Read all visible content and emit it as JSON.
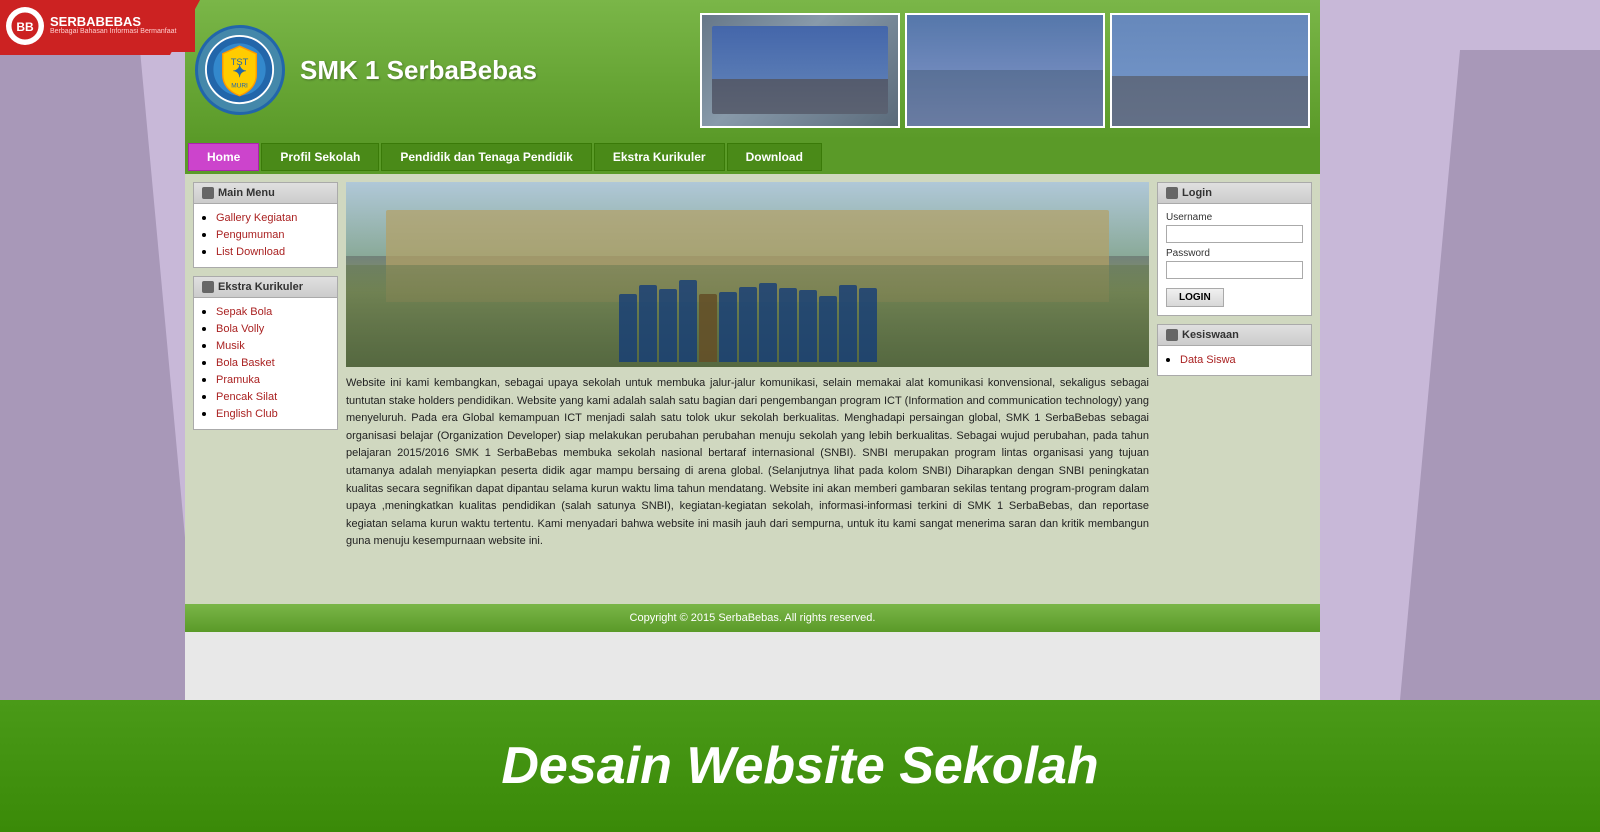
{
  "site": {
    "title": "SMK 1 SerbaBebas",
    "logo_text": "Berbagai Bahasan Informasi Bermanfaat",
    "copyright": "Copyright © 2015 SerbaBebas. All rights reserved."
  },
  "nav": {
    "items": [
      {
        "label": "Home",
        "active": true
      },
      {
        "label": "Profil Sekolah",
        "active": false
      },
      {
        "label": "Pendidik dan Tenaga Pendidik",
        "active": false
      },
      {
        "label": "Ekstra Kurikuler",
        "active": false
      },
      {
        "label": "Download",
        "active": false
      }
    ]
  },
  "sidebar": {
    "main_menu": {
      "title": "Main Menu",
      "items": [
        {
          "label": "Gallery Kegiatan",
          "href": "#"
        },
        {
          "label": "Pengumuman",
          "href": "#"
        },
        {
          "label": "List Download",
          "href": "#"
        }
      ]
    },
    "ekstra_kurikuler": {
      "title": "Ekstra Kurikuler",
      "items": [
        {
          "label": "Sepak Bola",
          "href": "#"
        },
        {
          "label": "Bola Volly",
          "href": "#"
        },
        {
          "label": "Musik",
          "href": "#"
        },
        {
          "label": "Bola Basket",
          "href": "#"
        },
        {
          "label": "Pramuka",
          "href": "#"
        },
        {
          "label": "Pencak Silat",
          "href": "#"
        },
        {
          "label": "English Club",
          "href": "#"
        }
      ]
    }
  },
  "login": {
    "title": "Login",
    "username_label": "Username",
    "password_label": "Password",
    "button_label": "LOGIN"
  },
  "kesiswaan": {
    "title": "Kesiswaan",
    "items": [
      {
        "label": "Data Siswa",
        "href": "#"
      }
    ]
  },
  "article": {
    "text": "Website ini kami kembangkan, sebagai upaya sekolah untuk membuka jalur-jalur komunikasi, selain memakai alat komunikasi konvensional, sekaligus sebagai tuntutan stake holders pendidikan. Website yang kami adalah salah satu bagian dari pengembangan program ICT (Information and communication technology) yang menyeluruh. Pada era Global kemampuan ICT menjadi salah satu tolok ukur sekolah berkualitas. Menghadapi persaingan global, SMK 1 SerbaBebas sebagai organisasi belajar (Organization Developer) siap melakukan perubahan perubahan menuju sekolah yang lebih berkualitas. Sebagai wujud perubahan, pada tahun pelajaran 2015/2016 SMK 1 SerbaBebas membuka sekolah nasional bertaraf internasional (SNBI). SNBI merupakan program lintas organisasi yang tujuan utamanya adalah menyiapkan peserta didik agar mampu bersaing di arena global. (Selanjutnya lihat pada kolom SNBI) Diharapkan dengan SNBI peningkatan kualitas secara segnifikan dapat dipantau selama kurun waktu lima tahun mendatang. Website ini akan memberi gambaran sekilas tentang program-program dalam upaya ,meningkatkan kualitas pendidikan (salah satunya SNBI), kegiatan-kegiatan sekolah, informasi-informasi terkini di SMK 1 SerbaBebas, dan reportase kegiatan selama kurun waktu tertentu. Kami menyadari bahwa website ini masih jauh dari sempurna, untuk itu kami sangat menerima saran dan kritik membangun guna menuju kesempurnaan website ini."
  },
  "bottom_banner": {
    "text": "Desain Website Sekolah"
  }
}
